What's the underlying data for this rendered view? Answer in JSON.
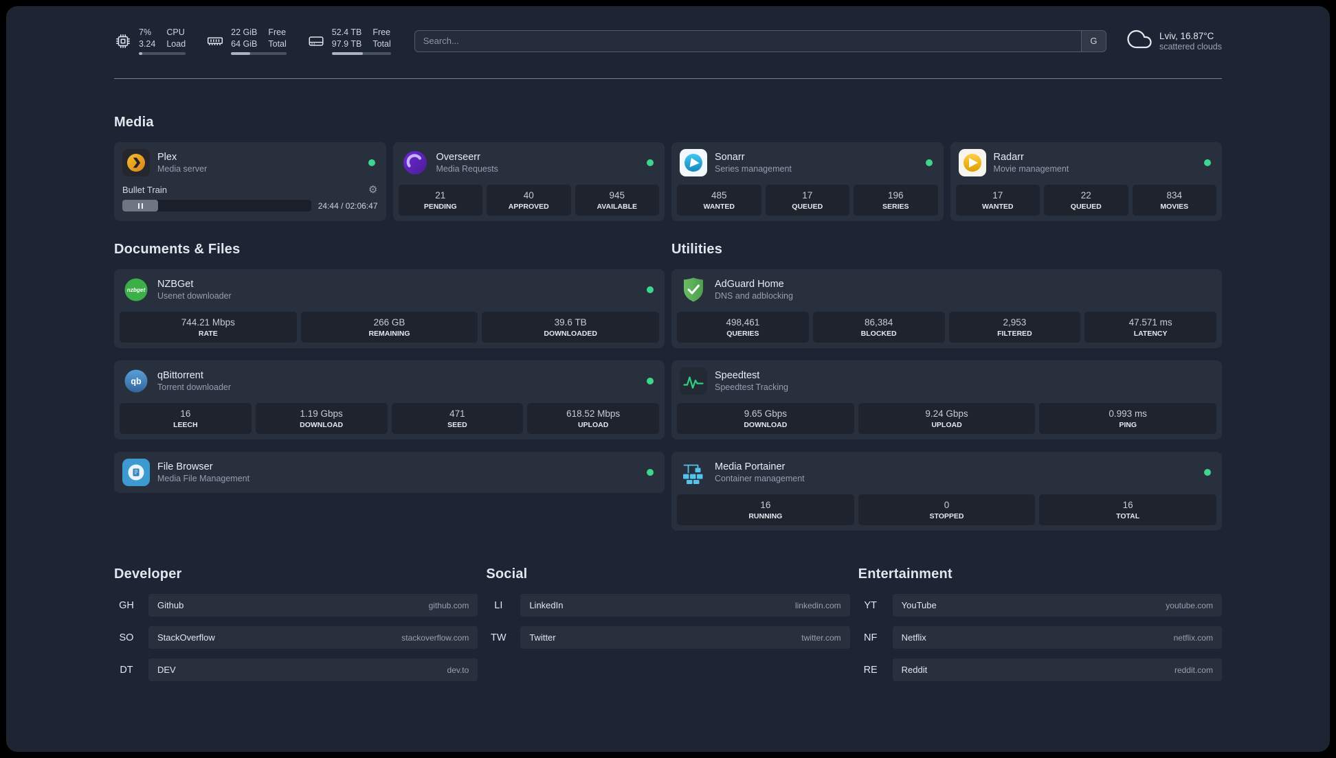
{
  "colors": {
    "status_online": "#3dd68c",
    "accent_green": "#2fd180"
  },
  "topbar": {
    "resources": [
      {
        "value_top": "7%",
        "value_bottom": "3.24",
        "label_top": "CPU",
        "label_bottom": "Load",
        "progress_pct": 8
      },
      {
        "value_top": "22 GiB",
        "value_bottom": "64 GiB",
        "label_top": "Free",
        "label_bottom": "Total",
        "progress_pct": 34
      },
      {
        "value_top": "52.4 TB",
        "value_bottom": "97.9 TB",
        "label_top": "Free",
        "label_bottom": "Total",
        "progress_pct": 53
      }
    ],
    "search": {
      "placeholder": "Search...",
      "provider_label": "G"
    },
    "weather": {
      "location": "Lviv, 16.87°C",
      "condition": "scattered clouds"
    }
  },
  "sections": {
    "media": {
      "title": "Media",
      "cards": [
        {
          "name": "Plex",
          "subtitle": "Media server",
          "player": {
            "title": "Bullet Train",
            "time": "24:44 / 02:06:47",
            "progress_pct": 19
          }
        },
        {
          "name": "Overseerr",
          "subtitle": "Media Requests",
          "stats": [
            {
              "value": "21",
              "label": "PENDING"
            },
            {
              "value": "40",
              "label": "APPROVED"
            },
            {
              "value": "945",
              "label": "AVAILABLE"
            }
          ]
        },
        {
          "name": "Sonarr",
          "subtitle": "Series management",
          "stats": [
            {
              "value": "485",
              "label": "WANTED"
            },
            {
              "value": "17",
              "label": "QUEUED"
            },
            {
              "value": "196",
              "label": "SERIES"
            }
          ]
        },
        {
          "name": "Radarr",
          "subtitle": "Movie management",
          "stats": [
            {
              "value": "17",
              "label": "WANTED"
            },
            {
              "value": "22",
              "label": "QUEUED"
            },
            {
              "value": "834",
              "label": "MOVIES"
            }
          ]
        }
      ]
    },
    "documents": {
      "title": "Documents & Files",
      "cards": [
        {
          "name": "NZBGet",
          "subtitle": "Usenet downloader",
          "stats": [
            {
              "value": "744.21 Mbps",
              "label": "RATE"
            },
            {
              "value": "266 GB",
              "label": "REMAINING"
            },
            {
              "value": "39.6 TB",
              "label": "DOWNLOADED"
            }
          ]
        },
        {
          "name": "qBittorrent",
          "subtitle": "Torrent downloader",
          "stats": [
            {
              "value": "16",
              "label": "LEECH"
            },
            {
              "value": "1.19 Gbps",
              "label": "DOWNLOAD"
            },
            {
              "value": "471",
              "label": "SEED"
            },
            {
              "value": "618.52 Mbps",
              "label": "UPLOAD"
            }
          ]
        },
        {
          "name": "File Browser",
          "subtitle": "Media File Management"
        }
      ]
    },
    "utilities": {
      "title": "Utilities",
      "cards": [
        {
          "name": "AdGuard Home",
          "subtitle": "DNS and adblocking",
          "stats": [
            {
              "value": "498,461",
              "label": "QUERIES"
            },
            {
              "value": "86,384",
              "label": "BLOCKED"
            },
            {
              "value": "2,953",
              "label": "FILTERED"
            },
            {
              "value": "47.571 ms",
              "label": "LATENCY"
            }
          ]
        },
        {
          "name": "Speedtest",
          "subtitle": "Speedtest Tracking",
          "stats": [
            {
              "value": "9.65 Gbps",
              "label": "DOWNLOAD"
            },
            {
              "value": "9.24 Gbps",
              "label": "UPLOAD"
            },
            {
              "value": "0.993 ms",
              "label": "PING"
            }
          ]
        },
        {
          "name": "Media Portainer",
          "subtitle": "Container management",
          "stats": [
            {
              "value": "16",
              "label": "RUNNING"
            },
            {
              "value": "0",
              "label": "STOPPED"
            },
            {
              "value": "16",
              "label": "TOTAL"
            }
          ]
        }
      ]
    }
  },
  "bookmarks": [
    {
      "title": "Developer",
      "items": [
        {
          "abbr": "GH",
          "name": "Github",
          "domain": "github.com"
        },
        {
          "abbr": "SO",
          "name": "StackOverflow",
          "domain": "stackoverflow.com"
        },
        {
          "abbr": "DT",
          "name": "DEV",
          "domain": "dev.to"
        }
      ]
    },
    {
      "title": "Social",
      "items": [
        {
          "abbr": "LI",
          "name": "LinkedIn",
          "domain": "linkedin.com"
        },
        {
          "abbr": "TW",
          "name": "Twitter",
          "domain": "twitter.com"
        }
      ]
    },
    {
      "title": "Entertainment",
      "items": [
        {
          "abbr": "YT",
          "name": "YouTube",
          "domain": "youtube.com"
        },
        {
          "abbr": "NF",
          "name": "Netflix",
          "domain": "netflix.com"
        },
        {
          "abbr": "RE",
          "name": "Reddit",
          "domain": "reddit.com"
        }
      ]
    }
  ]
}
